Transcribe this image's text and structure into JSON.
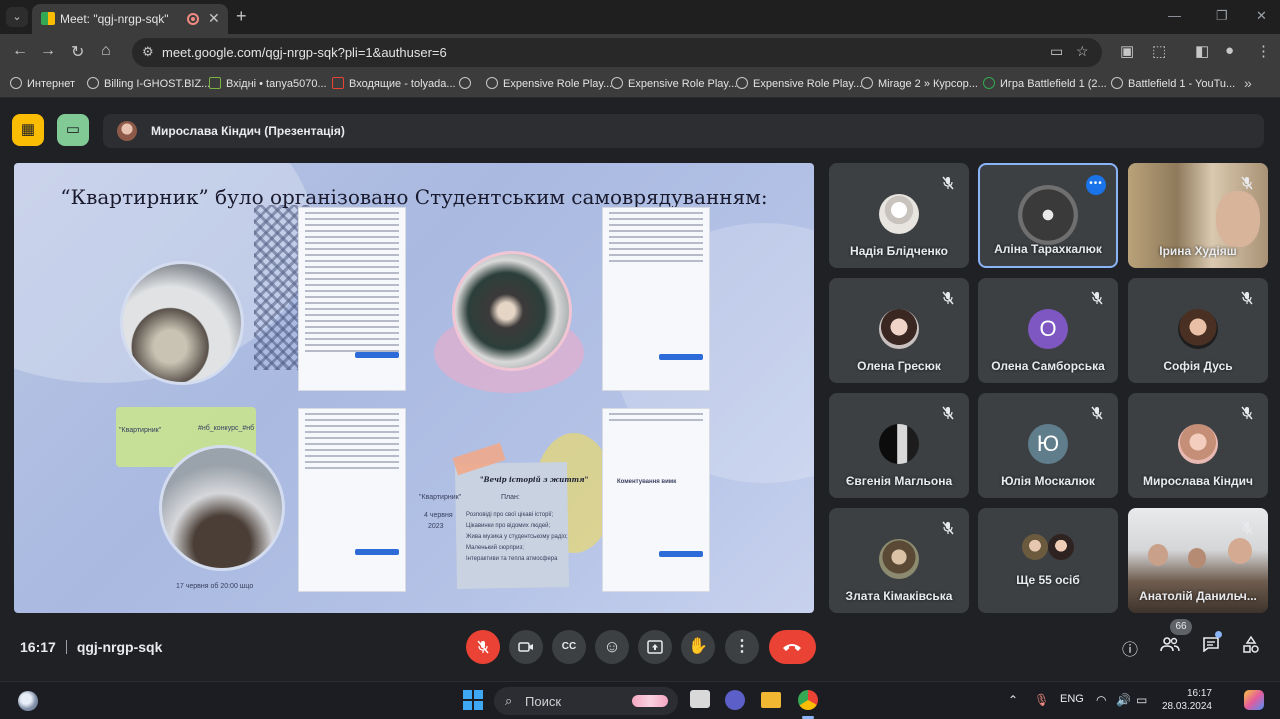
{
  "browser": {
    "tab_title": "Meet: \"qgj-nrgp-sqk\"",
    "url": "meet.google.com/qgj-nrgp-sqk?pli=1&authuser=6",
    "bookmarks": [
      "Интернет",
      "Billing I-GHOST.BIZ...",
      "Вхідні • tanya5070...",
      "Входящие - tolyada...",
      "",
      "Expensive Role Play...",
      "Expensive Role Play...",
      "Expensive Role Play...",
      "Mirage 2 » Курсор...",
      "Игра Battlefield 1 (2...",
      "Battlefield 1 - YouTu..."
    ]
  },
  "meet": {
    "presenter": "Мирослава Кіндич (Презентація)",
    "slide": {
      "title": "“Квартирник” було організовано Студентським самоврядуванням:",
      "label_kvartyrnyk": "\"Квартирник\"",
      "hashtag": "#нб_конкурс_#нб",
      "poster_title": "\"Вечір історій з життя\"",
      "poster_subtitle": "План:",
      "poster_items": [
        "Розповіді про свої цікаві історії;",
        "Цікавинки про відомих людей;",
        "Жива музика у студентському радіо;",
        "Маленький сюрприз;",
        "Інтерактиви та тепла атмосфера"
      ],
      "poster_left_1": "\"Квартирник\"",
      "poster_left_2": "4 червня",
      "poster_left_3": "2023",
      "comments_label": "Коментування вимк",
      "date_caption": "17 червня об 20:00 шцо"
    },
    "participants": [
      {
        "name": "Надія Блідченко",
        "type": "avatar",
        "color": "#d8d4cf",
        "muted": true
      },
      {
        "name": "Аліна Тарахкалюк",
        "type": "avatar",
        "color": "#4a4a4a",
        "muted": false,
        "selected": true
      },
      {
        "name": "Ірина Худіяш",
        "type": "video",
        "muted": true
      },
      {
        "name": "Олена Гресюк",
        "type": "avatar",
        "color": "#c78b7d",
        "muted": true
      },
      {
        "name": "Олена Самборська",
        "type": "letter",
        "letter": "О",
        "color": "#7e57c2",
        "muted": true
      },
      {
        "name": "Софія Дусь",
        "type": "avatar",
        "color": "#6b4e3d",
        "muted": true
      },
      {
        "name": "Євгенія Магльона",
        "type": "avatar",
        "color": "#2a2a2a",
        "muted": true
      },
      {
        "name": "Юлія Москалюк",
        "type": "letter",
        "letter": "Ю",
        "color": "#607d8b",
        "muted": true
      },
      {
        "name": "Мирослава Кіндич",
        "type": "avatar",
        "color": "#e7a7a0",
        "muted": true
      },
      {
        "name": "Злата Кімаківська",
        "type": "avatar",
        "color": "#8a7558",
        "muted": true
      },
      {
        "name": "Ще 55 осіб",
        "type": "more",
        "muted": false
      },
      {
        "name": "Анатолій Данильч...",
        "type": "video",
        "muted": true
      }
    ],
    "time": "16:17",
    "meeting_code": "qgj-nrgp-sqk",
    "people_count": "66"
  },
  "taskbar": {
    "search_placeholder": "Поиск",
    "lang": "ENG",
    "clock_time": "16:17",
    "clock_date": "28.03.2024"
  }
}
